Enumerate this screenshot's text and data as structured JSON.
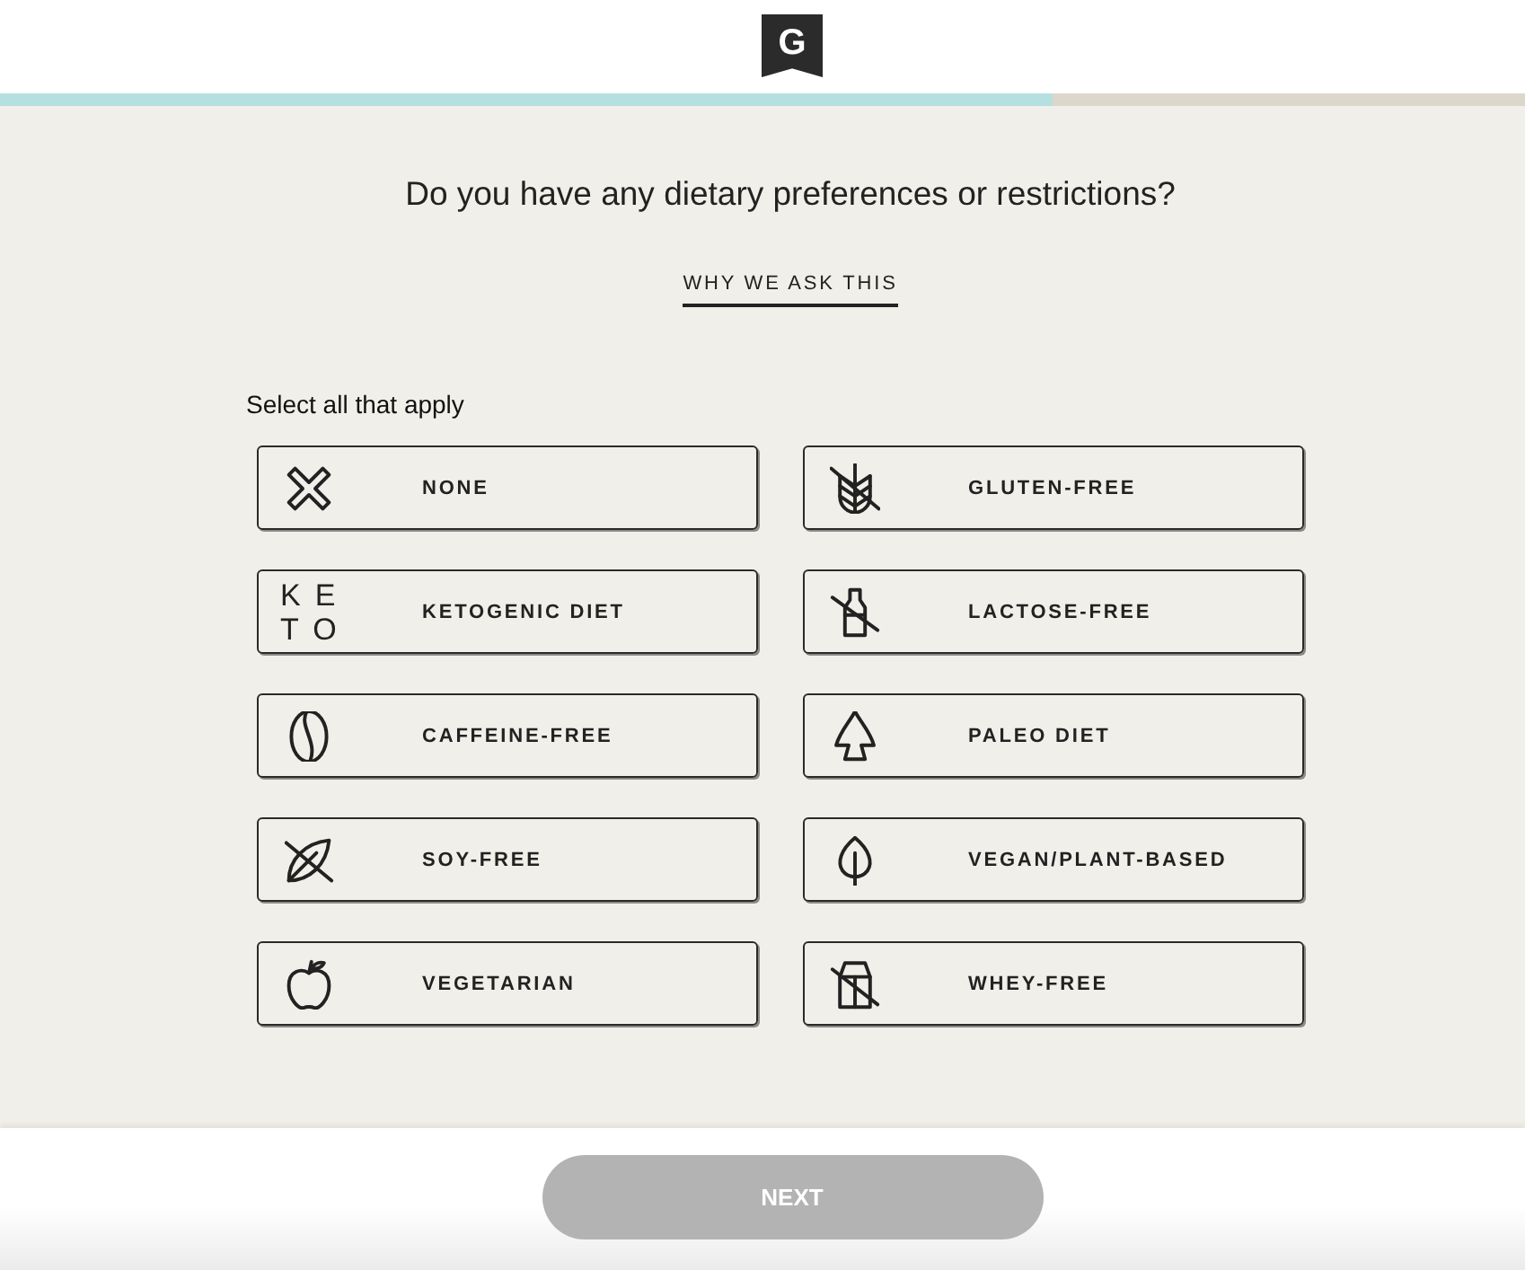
{
  "header": {
    "logo": "G"
  },
  "progress": {
    "level": 0.69
  },
  "question": "Do you have any dietary preferences or restrictions?",
  "why_link": "WHY WE ASK THIS",
  "instruction": "Select all that apply",
  "options": [
    {
      "label": "NONE",
      "kind": "cross",
      "selected": false
    },
    {
      "label": "GLUTEN-FREE",
      "kind": "wheat-crossed",
      "selected": false
    },
    {
      "label": "KETOGENIC DIET",
      "kind": "text-mark",
      "icon_text": [
        "KE",
        "TO"
      ],
      "selected": false
    },
    {
      "label": "LACTOSE-FREE",
      "kind": "bottle-crossed",
      "selected": false
    },
    {
      "label": "CAFFEINE-FREE",
      "kind": "bean",
      "selected": false
    },
    {
      "label": "PALEO DIET",
      "kind": "arrowhead",
      "selected": false
    },
    {
      "label": "SOY-FREE",
      "kind": "pod-crossed",
      "selected": false
    },
    {
      "label": "VEGAN/PLANT-BASED",
      "kind": "leaf",
      "selected": false
    },
    {
      "label": "VEGETARIAN",
      "kind": "apple",
      "selected": false
    },
    {
      "label": "WHEY-FREE",
      "kind": "carton-crossed",
      "selected": false
    }
  ],
  "footer": {
    "next_button": {
      "label": "NEXT",
      "disabled": true
    }
  }
}
